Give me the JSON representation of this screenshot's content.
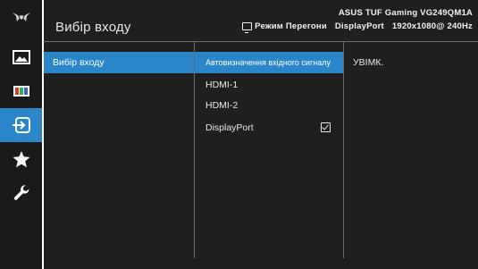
{
  "header": {
    "title": "Вибір входу",
    "model": "ASUS TUF Gaming  VG249QM1A",
    "mode": "Режим Перегони",
    "input": "DisplayPort",
    "resolution": "1920x1080@ 240Hz"
  },
  "sidebar": {
    "items": [
      {
        "icon": "tuf-logo-icon",
        "active": false
      },
      {
        "icon": "image-icon",
        "active": false
      },
      {
        "icon": "color-icon",
        "active": false
      },
      {
        "icon": "input-select-icon",
        "active": true
      },
      {
        "icon": "star-icon",
        "active": false
      },
      {
        "icon": "wrench-icon",
        "active": false
      }
    ]
  },
  "menu": {
    "level1": [
      {
        "label": "Вибір входу",
        "active": true
      }
    ],
    "level2": [
      {
        "label": "Автовизначення вхідного сигналу",
        "active": true,
        "checked": false
      },
      {
        "label": "HDMI-1",
        "active": false,
        "checked": false
      },
      {
        "label": "HDMI-2",
        "active": false,
        "checked": false
      },
      {
        "label": "DisplayPort",
        "active": false,
        "checked": true
      }
    ],
    "level3": [
      {
        "label": "УВІМК.",
        "active": false
      }
    ]
  },
  "colors": {
    "accent": "#2a86c9",
    "panel": "#1f1f1f",
    "rail": "#1a1a1a",
    "divider": "#6a6a6a"
  }
}
